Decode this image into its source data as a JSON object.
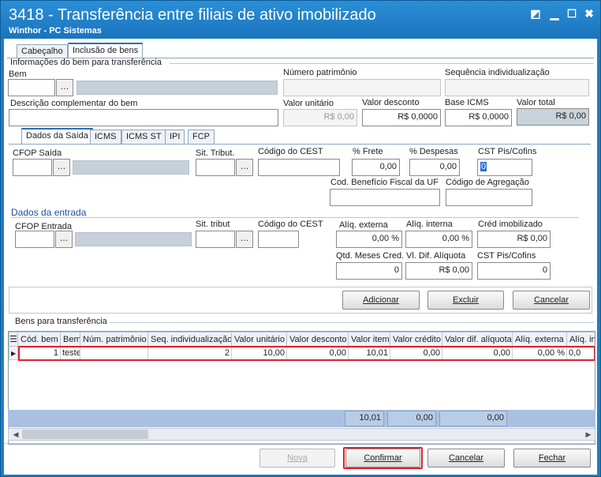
{
  "window": {
    "title": "3418 - Transferência entre filiais de ativo imobilizado",
    "subtitle": "Winthor - PC Sistemas",
    "restore_glyph": "◩",
    "minimize_glyph": "▁",
    "maximize_glyph": "☐",
    "close_glyph": "✖"
  },
  "top_tabs": [
    "Cabeçalho",
    "Inclusão de bens"
  ],
  "bem_info": {
    "legend": "Informações do bem para transferência",
    "bem_label": "Bem",
    "bem_value": "",
    "numero_patrimonio_label": "Número patrimônio",
    "numero_patrimonio_value": "",
    "sequencia_label": "Sequência individualização",
    "sequencia_value": "",
    "descricao_label": "Descrição complementar do bem",
    "descricao_value": "",
    "valor_unitario_label": "Valor unitário",
    "valor_unitario_value": "R$ 0,00",
    "valor_desconto_label": "Valor desconto",
    "valor_desconto_value": "R$ 0,0000",
    "base_icms_label": "Base ICMS",
    "base_icms_value": "R$ 0,0000",
    "valor_total_label": "Valor total",
    "valor_total_value": "R$ 0,00"
  },
  "inner_tabs": [
    "Dados da Saída",
    "ICMS",
    "ICMS ST",
    "IPI",
    "FCP"
  ],
  "saida": {
    "cfop_label": "CFOP Saída",
    "cfop_value": "",
    "sit_trib_label": "Sit. Tribut.",
    "sit_trib_value": "",
    "cest_label": "Código do CEST",
    "cest_value": "",
    "frete_label": "% Frete",
    "frete_value": "0,00",
    "despesas_label": "% Despesas",
    "despesas_value": "0,00",
    "cst_label": "CST Pis/Cofins",
    "cst_value": "0",
    "beneficio_label": "Cod. Benefício Fiscal da UF",
    "beneficio_value": "",
    "agregacao_label": "Código de Agregação",
    "agregacao_value": ""
  },
  "entrada": {
    "section_title": "Dados da entrada",
    "cfop_label": "CFOP Entrada",
    "cfop_value": "",
    "sit_trib_label": "Sit. tribut",
    "sit_trib_value": "",
    "cest_label": "Código do CEST",
    "cest_value": "",
    "aliq_externa_label": "Alíq. externa",
    "aliq_externa_value": "0,00 %",
    "aliq_interna_label": "Alíq. interna",
    "aliq_interna_value": "0,00 %",
    "cred_imob_label": "Créd imobilizado",
    "cred_imob_value": "R$ 0,00",
    "qtd_meses_label": "Qtd. Meses Cred.",
    "qtd_meses_value": "0",
    "vl_dif_label": "Vl. Dif. Alíquota",
    "vl_dif_value": "R$ 0,00",
    "cst_label": "CST Pis/Cofins",
    "cst_value": "0"
  },
  "item_buttons": {
    "adicionar": "Adicionar",
    "excluir": "Excluir",
    "cancelar": "Cancelar"
  },
  "grid": {
    "legend": "Bens para transferência",
    "columns": [
      "Cód. bem",
      "Bem",
      "Núm. patrimônio",
      "Seq. individualização",
      "Valor unitário",
      "Valor desconto",
      "Valor item",
      "Valor crédito",
      "Valor dif. alíquota",
      "Alíq. externa",
      "Alíq. int"
    ],
    "rows": [
      [
        "1",
        "teste",
        "",
        "2",
        "10,00",
        "0,00",
        "10,01",
        "0,00",
        "0,00",
        "0,00 %",
        "0,0"
      ]
    ],
    "totals": {
      "valor_item": "10,01",
      "valor_credito": "0,00",
      "valor_dif_aliquota": "0,00"
    },
    "row_indicator": "▶",
    "menu_glyph": "☰"
  },
  "footer_buttons": {
    "nova": "Nova",
    "confirmar": "Confirmar",
    "cancelar": "Cancelar",
    "fechar": "Fechar"
  },
  "colors": {
    "titlebar": "#1a74bd",
    "highlight_red": "#e0202a",
    "grid_total_row": "#a9c0e0",
    "readonly_field": "#c9d3dc"
  }
}
